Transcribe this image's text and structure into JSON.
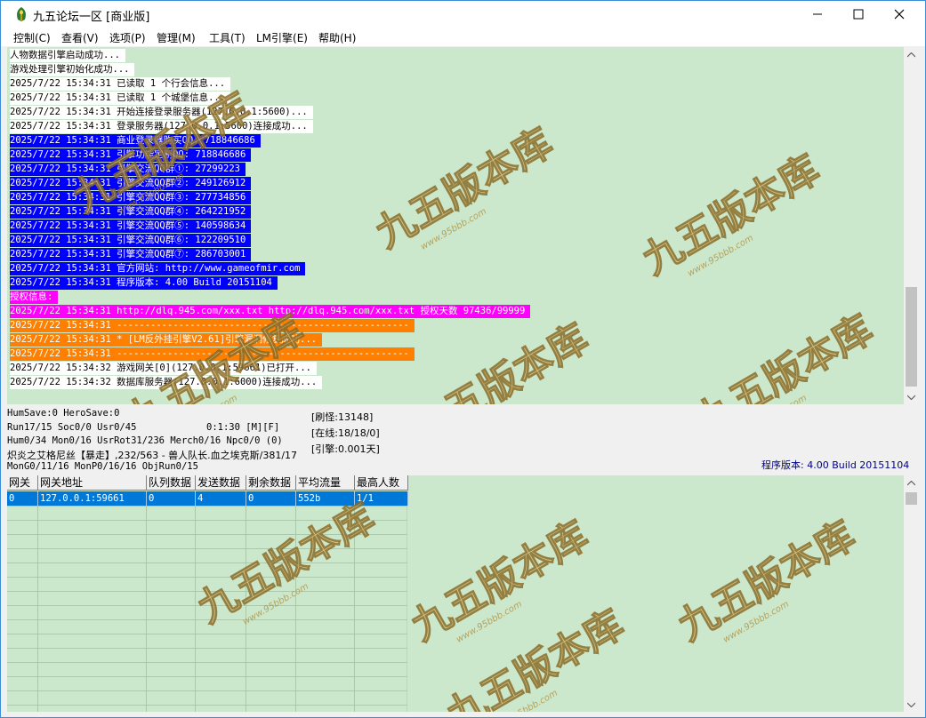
{
  "window": {
    "title": "九五论坛一区 [商业版]"
  },
  "menu": [
    "控制(C)",
    "查看(V)",
    "选项(P)",
    "管理(M)",
    "工具(T)",
    "LM引擎(E)",
    "帮助(H)"
  ],
  "log_lines": [
    {
      "text": "人物数据引擎启动成功...",
      "bg": "#ffffff",
      "fg": "#000000"
    },
    {
      "text": "游戏处理引擎初始化成功...",
      "bg": "#ffffff",
      "fg": "#000000"
    },
    {
      "text": "2025/7/22 15:34:31 已读取 1 个行会信息...",
      "bg": "#ffffff",
      "fg": "#000000"
    },
    {
      "text": "2025/7/22 15:34:31 已读取 1 个城堡信息...",
      "bg": "#ffffff",
      "fg": "#000000"
    },
    {
      "text": "2025/7/22 15:34:31 开始连接登录服务器(127.0.0.1:5600)...",
      "bg": "#ffffff",
      "fg": "#000000"
    },
    {
      "text": "2025/7/22 15:34:31 登录服务器(127.0.0.1:5600)连接成功...",
      "bg": "#ffffff",
      "fg": "#000000"
    },
    {
      "text": "2025/7/22 15:34:31 商业登录器购买QQ: 718846686",
      "bg": "#0000ff",
      "fg": "#ffffff"
    },
    {
      "text": "2025/7/22 15:34:31 引擎功能定制QQ: 718846686",
      "bg": "#0000ff",
      "fg": "#ffffff"
    },
    {
      "text": "2025/7/22 15:34:31 引擎交流QQ群①: 27299223",
      "bg": "#0000ff",
      "fg": "#ffffff"
    },
    {
      "text": "2025/7/22 15:34:31 引擎交流QQ群②: 249126912",
      "bg": "#0000ff",
      "fg": "#ffffff"
    },
    {
      "text": "2025/7/22 15:34:31 引擎交流QQ群③: 277734856",
      "bg": "#0000ff",
      "fg": "#ffffff"
    },
    {
      "text": "2025/7/22 15:34:31 引擎交流QQ群④: 264221952",
      "bg": "#0000ff",
      "fg": "#ffffff"
    },
    {
      "text": "2025/7/22 15:34:31 引擎交流QQ群⑤: 140598634",
      "bg": "#0000ff",
      "fg": "#ffffff"
    },
    {
      "text": "2025/7/22 15:34:31 引擎交流QQ群⑥: 122209510",
      "bg": "#0000ff",
      "fg": "#ffffff"
    },
    {
      "text": "2025/7/22 15:34:31 引擎交流QQ群⑦: 286703001",
      "bg": "#0000ff",
      "fg": "#ffffff"
    },
    {
      "text": "2025/7/22 15:34:31 官方网站: http://www.gameofmir.com",
      "bg": "#0000ff",
      "fg": "#ffffff"
    },
    {
      "text": "2025/7/22 15:34:31 程序版本: 4.00 Build 20151104",
      "bg": "#0000ff",
      "fg": "#ffffff"
    },
    {
      "text": "授权信息:",
      "bg": "#ff00ff",
      "fg": "#ffffff"
    },
    {
      "text": "2025/7/22 15:34:31 http://dlq.945.com/xxx.txt http://dlq.945.com/xxx.txt 授权天数 97436/99999",
      "bg": "#ff00ff",
      "fg": "#ffffff"
    },
    {
      "text": "2025/7/22 15:34:31 ----------------------------------------------------",
      "bg": "#ff8000",
      "fg": "#ffffff"
    },
    {
      "text": "2025/7/22 15:34:31 * [LM反外挂引擎V2.61]引擎漏洞修复成功...",
      "bg": "#ff8000",
      "fg": "#ffffff"
    },
    {
      "text": "2025/7/22 15:34:31 ----------------------------------------------------",
      "bg": "#ff8000",
      "fg": "#ffffff"
    },
    {
      "text": "2025/7/22 15:34:32 游戏网关[0](127.0.0.1:59661)已打开...",
      "bg": "#ffffff",
      "fg": "#000000"
    },
    {
      "text": "2025/7/22 15:34:32 数据库服务器(127.0.0.1:6000)连接成功...",
      "bg": "#ffffff",
      "fg": "#000000"
    }
  ],
  "status": {
    "line1": "HumSave:0 HeroSave:0",
    "line2": "Run17/15 Soc0/0 Usr0/45",
    "timer": "0:1:30 [M][F]",
    "line3": "Hum0/34 Mon0/16 UsrRot31/236 Merch0/16 Npc0/0 (0)",
    "line4": "炽炎之艾格尼丝【暴走】,232/563 - 兽人队长.血之埃克斯/381/17",
    "line5": "MonG0/11/16 MonP0/16/16 ObjRun0/15",
    "refresh": "[刷怪:13148]",
    "online": "[在线:18/18/0]",
    "engine": "[引擎:0.001天]",
    "version": "程序版本: 4.00 Build 20151104"
  },
  "grid": {
    "columns": [
      "网关",
      "网关地址",
      "队列数据",
      "发送数据",
      "剩余数据",
      "平均流量",
      "最高人数"
    ],
    "rows": [
      [
        "0",
        "127.0.0.1:59661",
        "0",
        "4",
        "0",
        "552b",
        "1/1"
      ]
    ]
  },
  "watermark": {
    "text": "九五版本库",
    "url": "www.95bbb.com"
  }
}
